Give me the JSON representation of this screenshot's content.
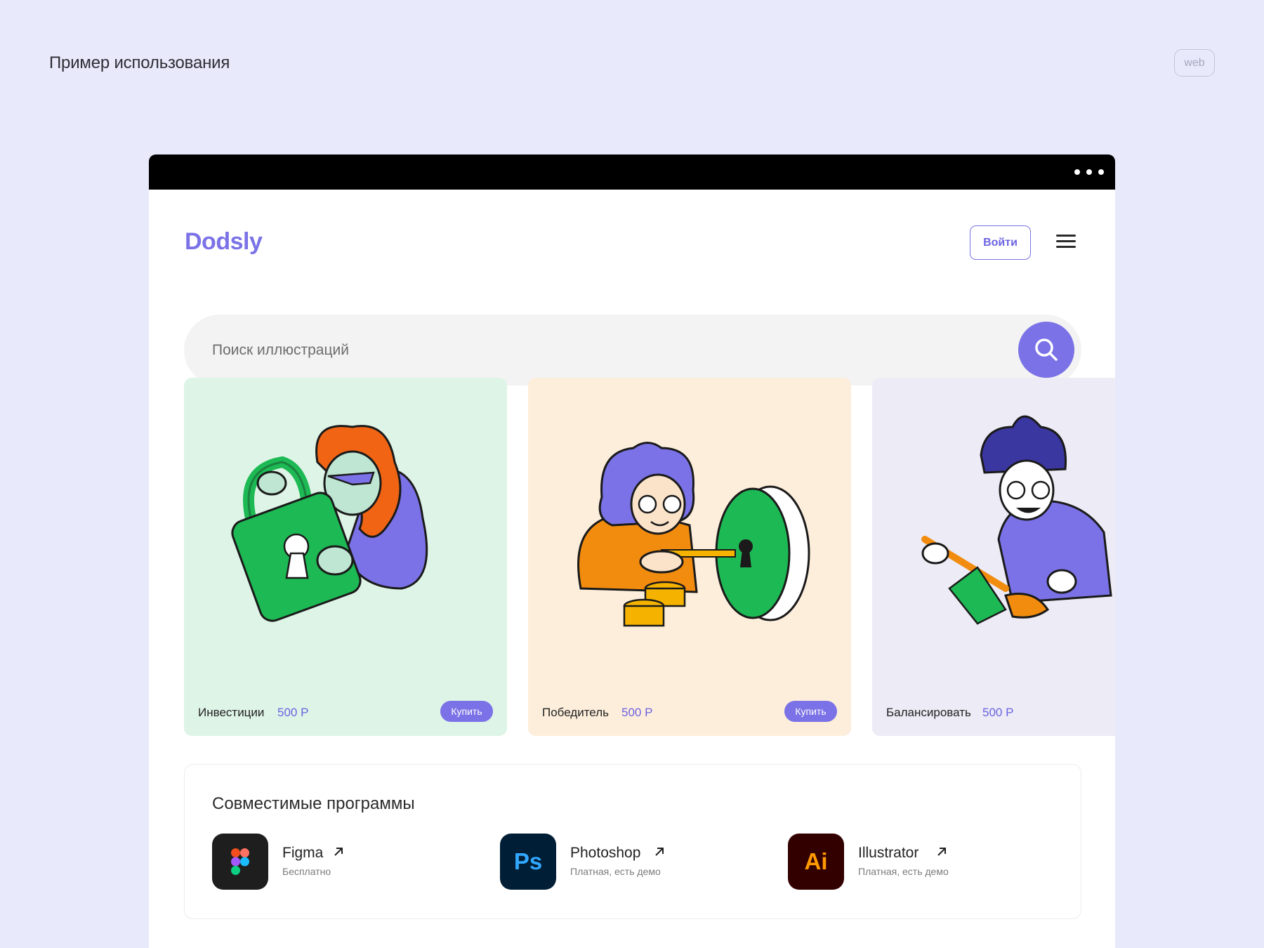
{
  "page": {
    "title": "Пример использования",
    "badge": "web"
  },
  "site": {
    "logo": "Dodsly",
    "login_label": "Войти",
    "search_placeholder": "Поиск иллюстраций"
  },
  "cards": [
    {
      "name": "Инвестиции",
      "price": "500 Р",
      "buy_label": "Купить",
      "bg": "#DEF4E7"
    },
    {
      "name": "Победитель",
      "price": "500 Р",
      "buy_label": "Купить",
      "bg": "#FDEEDB"
    },
    {
      "name": "Балансировать",
      "price": "500 Р",
      "bg": "#ECEBF6"
    }
  ],
  "programs": {
    "title": "Совместимые программы",
    "items": [
      {
        "name": "Figma",
        "sub": "Бесплатно",
        "icon": "figma-icon"
      },
      {
        "name": "Photoshop",
        "sub": "Платная, есть демо",
        "icon_text": "Ps",
        "icon": "photoshop-icon"
      },
      {
        "name": "Illustrator",
        "sub": "Платная, есть демо",
        "icon_text": "Ai",
        "icon": "illustrator-icon"
      }
    ]
  },
  "colors": {
    "page_bg": "#E8E9FB",
    "accent": "#7A72E6",
    "photoshop_bg": "#001E36",
    "photoshop_fg": "#31A8FF",
    "illustrator_bg": "#330000",
    "illustrator_fg": "#FF9A00"
  }
}
